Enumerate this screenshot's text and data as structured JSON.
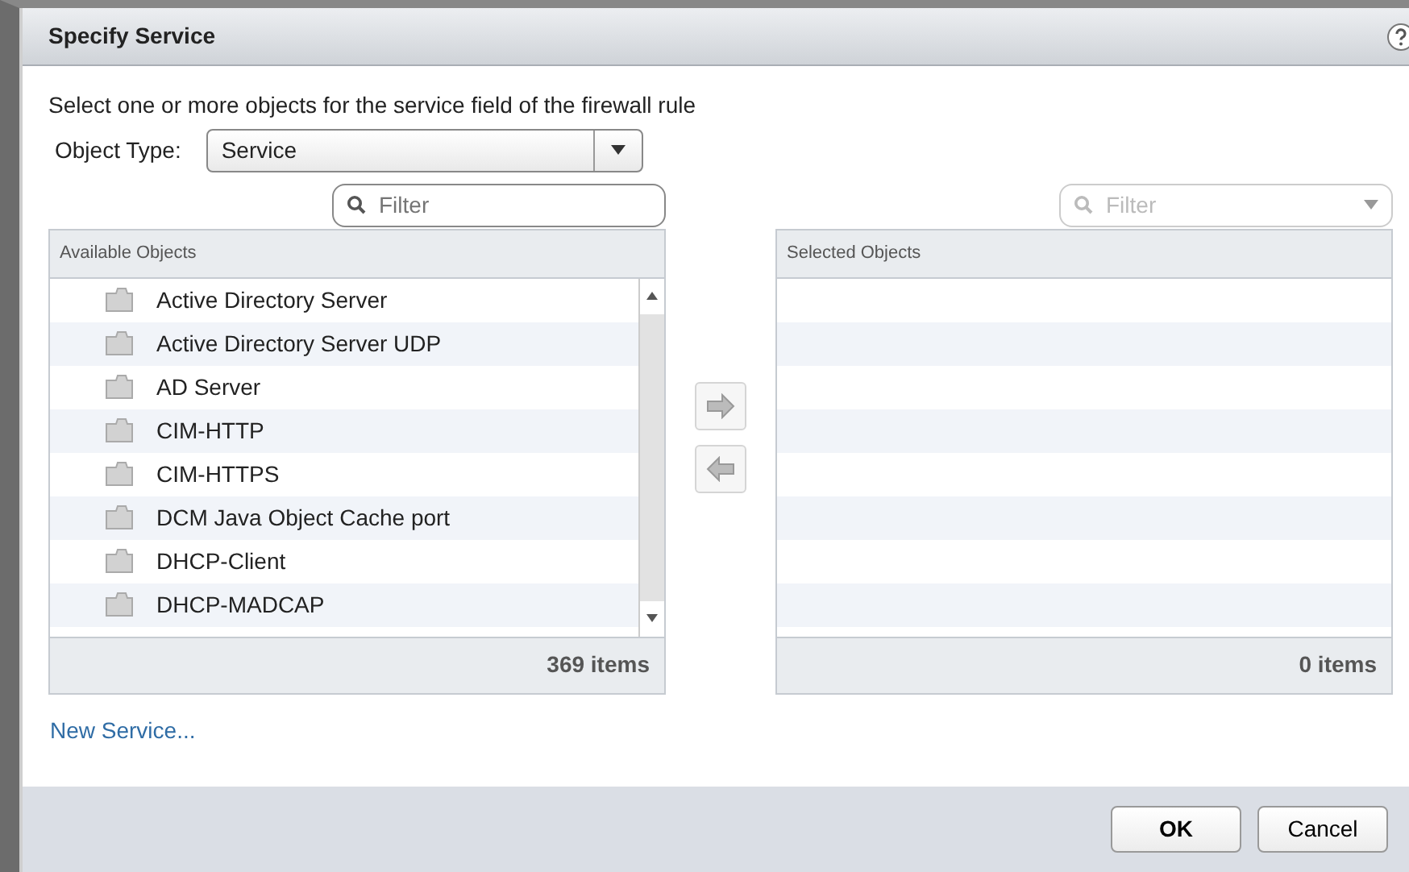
{
  "dialog": {
    "title": "Specify Service"
  },
  "description": "Select one or more objects for the service field of the firewall rule",
  "object_type": {
    "label": "Object Type:",
    "value": "Service"
  },
  "available": {
    "filter": {
      "placeholder": "Filter",
      "disabled": false
    },
    "header": "Available Objects",
    "count": "369 items",
    "items": [
      {
        "label": "Active Directory Server"
      },
      {
        "label": "Active Directory Server UDP"
      },
      {
        "label": "AD Server"
      },
      {
        "label": "CIM-HTTP"
      },
      {
        "label": "CIM-HTTPS"
      },
      {
        "label": "DCM Java Object Cache port"
      },
      {
        "label": "DHCP-Client"
      },
      {
        "label": "DHCP-MADCAP"
      }
    ]
  },
  "selected": {
    "filter": {
      "placeholder": "Filter",
      "disabled": true
    },
    "header": "Selected Objects",
    "count": "0 items"
  },
  "link": "New Service...",
  "buttons": [
    {
      "label": "OK",
      "primary": true
    },
    {
      "label": "Cancel",
      "primary": false
    }
  ]
}
